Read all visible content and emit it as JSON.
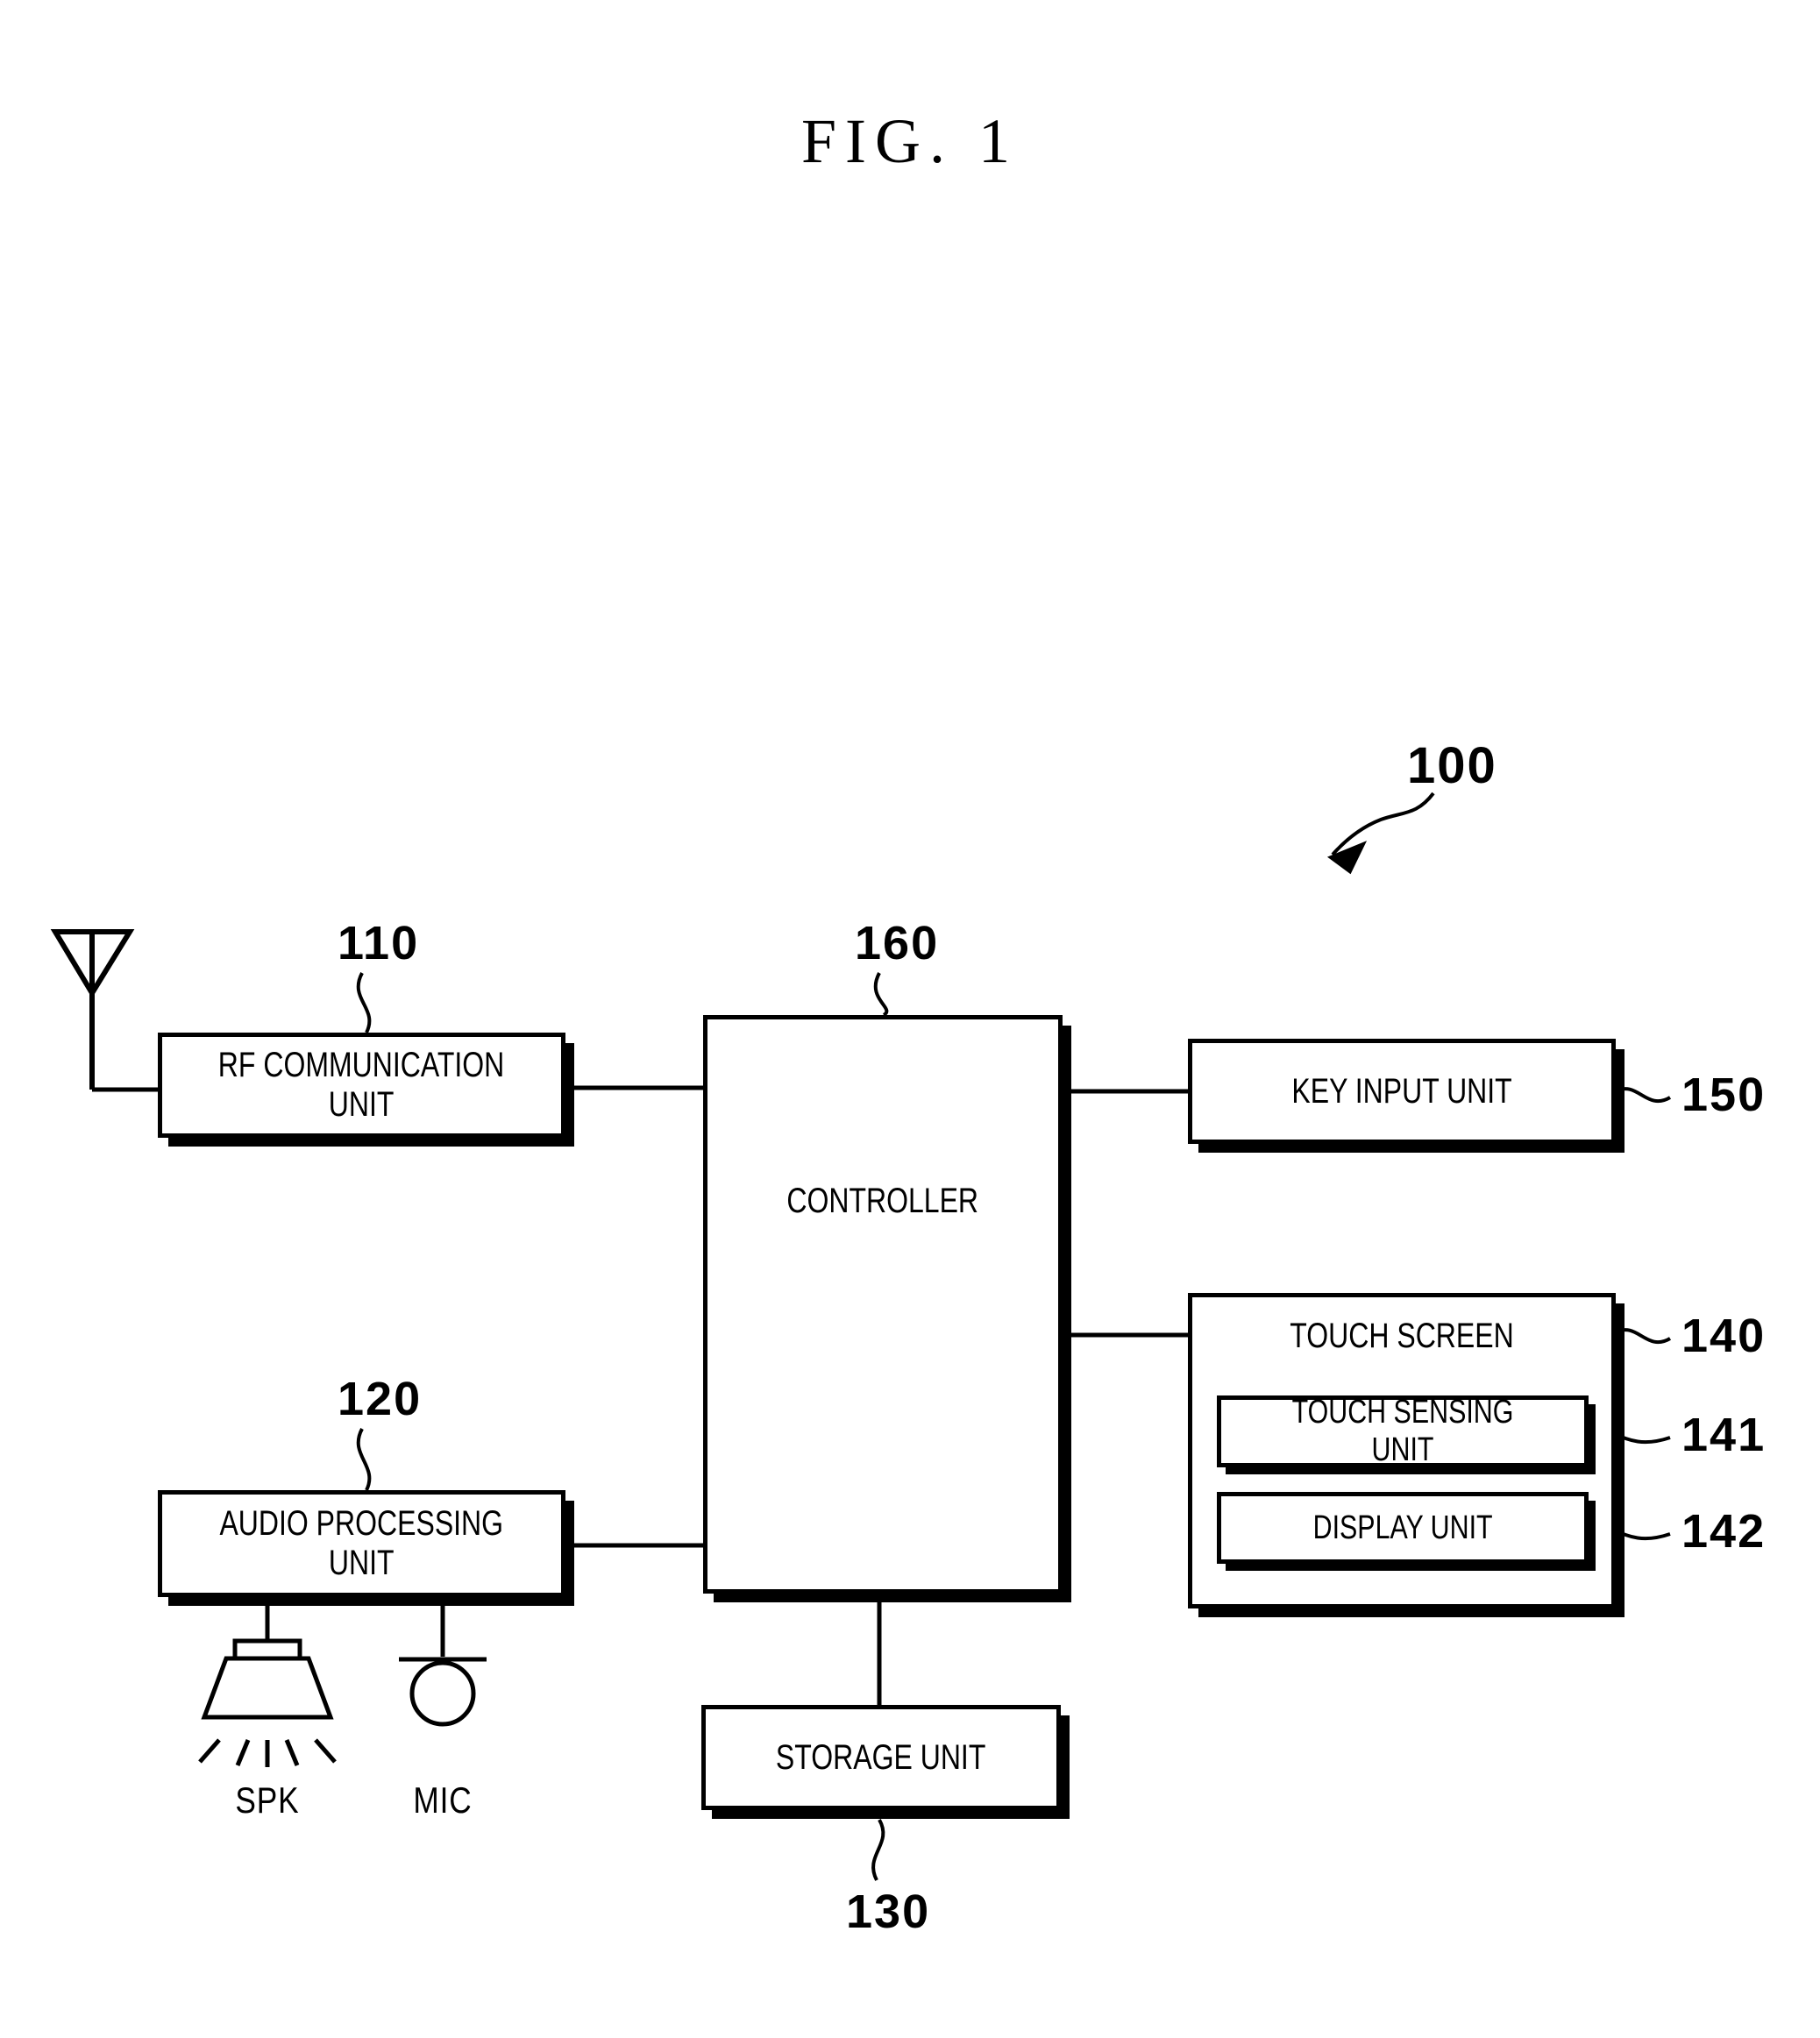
{
  "figure": {
    "title": "FIG. 1",
    "apparatus_ref": "100"
  },
  "blocks": {
    "rf_communication_unit": {
      "label": "RF COMMUNICATION\nUNIT",
      "ref": "110"
    },
    "audio_processing_unit": {
      "label": "AUDIO PROCESSING\nUNIT",
      "ref": "120"
    },
    "storage_unit": {
      "label": "STORAGE UNIT",
      "ref": "130"
    },
    "touch_screen": {
      "label": "TOUCH SCREEN",
      "ref": "140"
    },
    "touch_sensing_unit": {
      "label": "TOUCH SENSING UNIT",
      "ref": "141"
    },
    "display_unit": {
      "label": "DISPLAY UNIT",
      "ref": "142"
    },
    "key_input_unit": {
      "label": "KEY INPUT UNIT",
      "ref": "150"
    },
    "controller": {
      "label": "CONTROLLER",
      "ref": "160"
    }
  },
  "icons": {
    "antenna": "antenna-icon",
    "speaker": {
      "name": "speaker-icon",
      "caption": "SPK"
    },
    "microphone": {
      "name": "microphone-icon",
      "caption": "MIC"
    }
  },
  "colors": {
    "line": "#000000",
    "background": "#ffffff"
  }
}
